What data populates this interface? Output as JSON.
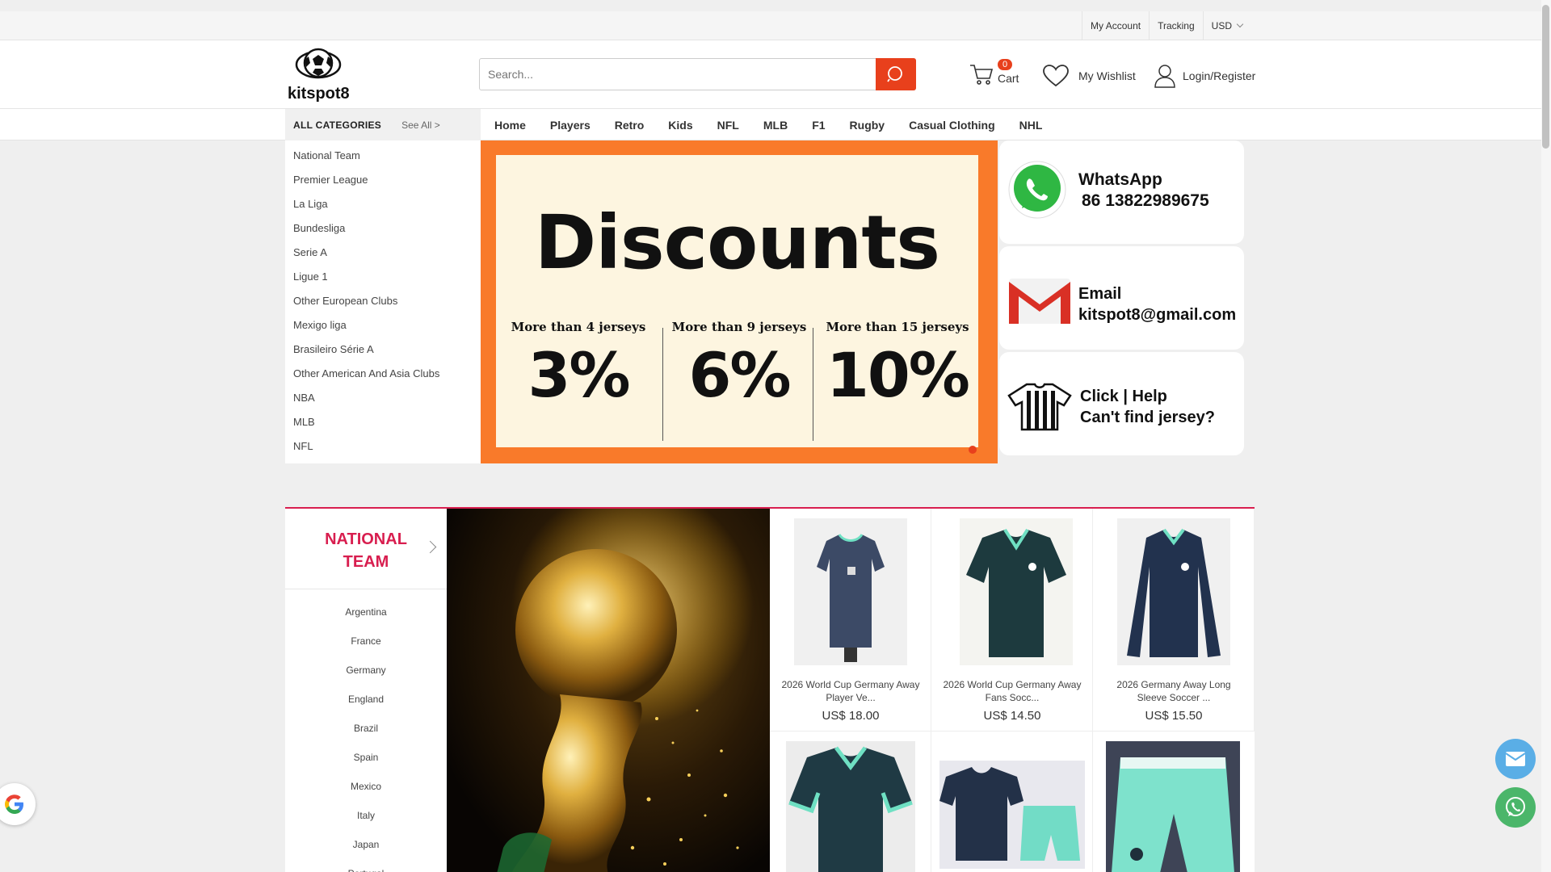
{
  "topbar": {
    "my_account": "My Account",
    "tracking": "Tracking",
    "currency": "USD"
  },
  "brand": {
    "name": "kitspot8"
  },
  "search": {
    "placeholder": "Search..."
  },
  "cart": {
    "count": "0",
    "label": "Cart"
  },
  "wishlist": {
    "label": "My Wishlist"
  },
  "login": {
    "label": "Login/Register"
  },
  "categories": {
    "title": "ALL CATEGORIES",
    "see_all": "See All >",
    "items": [
      "National Team",
      "Premier League",
      "La Liga",
      "Bundesliga",
      "Serie A",
      "Ligue 1",
      "Other European Clubs",
      "Mexigo liga",
      "Brasileiro Série  A",
      "Other American And Asia Clubs",
      "NBA",
      "MLB",
      "NFL"
    ]
  },
  "nav": [
    "Home",
    "Players",
    "Retro",
    "Kids",
    "NFL",
    "MLB",
    "F1",
    "Rugby",
    "Casual Clothing",
    "NHL"
  ],
  "banner": {
    "title": "Discounts",
    "tiers": [
      {
        "label": "More than 4 jerseys",
        "value": "3%"
      },
      {
        "label": "More than 9 jerseys",
        "value": "6%"
      },
      {
        "label": "More than 15 jerseys",
        "value": "10%"
      }
    ]
  },
  "contacts": {
    "whatsapp": {
      "title": "WhatsApp",
      "value": "86 13822989675"
    },
    "email": {
      "title": "Email",
      "value": "kitspot8@gmail.com"
    },
    "help": {
      "line1": "Click | Help",
      "line2": "Can't find  jersey?"
    }
  },
  "section": {
    "title_line1": "NATIONAL",
    "title_line2": "TEAM",
    "teams": [
      "Argentina",
      "France",
      "Germany",
      "England",
      "Brazil",
      "Spain",
      "Mexico",
      "Italy",
      "Japan",
      "Portugal"
    ]
  },
  "products": [
    {
      "name": "2026 World Cup Germany Away Player Ve...",
      "price": "US$ 18.00"
    },
    {
      "name": "2026 World Cup Germany Away Fans Socc...",
      "price": "US$ 14.50"
    },
    {
      "name": "2026 Germany Away Long Sleeve Soccer ...",
      "price": "US$ 15.50"
    }
  ],
  "colors": {
    "accent": "#e8401c",
    "section": "#d81e4f",
    "banner": "#f97a2a"
  }
}
